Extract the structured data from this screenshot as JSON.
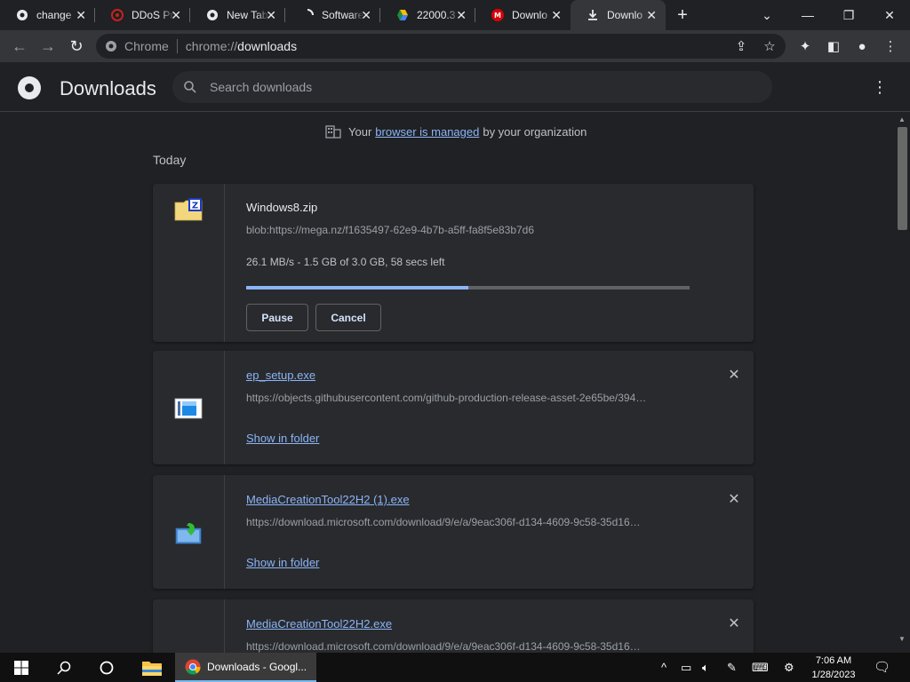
{
  "tabs": [
    {
      "title": "change",
      "favicon": "google-icon"
    },
    {
      "title": "DDoS Pr",
      "favicon": "ddos-icon"
    },
    {
      "title": "New Tab",
      "favicon": "chrome-icon"
    },
    {
      "title": "Software",
      "favicon": "loading-icon"
    },
    {
      "title": "22000.3",
      "favicon": "drive-icon"
    },
    {
      "title": "Downlo",
      "favicon": "mega-icon"
    },
    {
      "title": "Downlo",
      "favicon": "download-icon",
      "active": true
    }
  ],
  "omnibox": {
    "site": "Chrome",
    "url_prefix": "chrome://",
    "url_path": "downloads"
  },
  "header": {
    "title": "Downloads",
    "search_placeholder": "Search downloads"
  },
  "managed": {
    "before": "Your",
    "link": "browser is managed",
    "after": "by your organization"
  },
  "section_label": "Today",
  "downloads": [
    {
      "name": "Windows8.zip",
      "url": "blob:https://mega.nz/f1635497-62e9-4b7b-a5ff-fa8f5e83b7d6",
      "status": "26.1 MB/s - 1.5 GB of 3.0 GB, 58 secs left",
      "progress": 0.5,
      "pause_label": "Pause",
      "cancel_label": "Cancel"
    },
    {
      "name": "ep_setup.exe",
      "url": "https://objects.githubusercontent.com/github-production-release-asset-2e65be/394…",
      "action": "Show in folder"
    },
    {
      "name": "MediaCreationTool22H2 (1).exe",
      "url": "https://download.microsoft.com/download/9/e/a/9eac306f-d134-4609-9c58-35d16…",
      "action": "Show in folder"
    },
    {
      "name": "MediaCreationTool22H2.exe",
      "url": "https://download.microsoft.com/download/9/e/a/9eac306f-d134-4609-9c58-35d16…"
    }
  ],
  "taskbar": {
    "active_app": "Downloads - Googl...",
    "time": "7:06 AM",
    "date": "1/28/2023"
  },
  "colors": {
    "accent": "#8ab4f8",
    "background": "#202124",
    "card": "#292a2d"
  }
}
